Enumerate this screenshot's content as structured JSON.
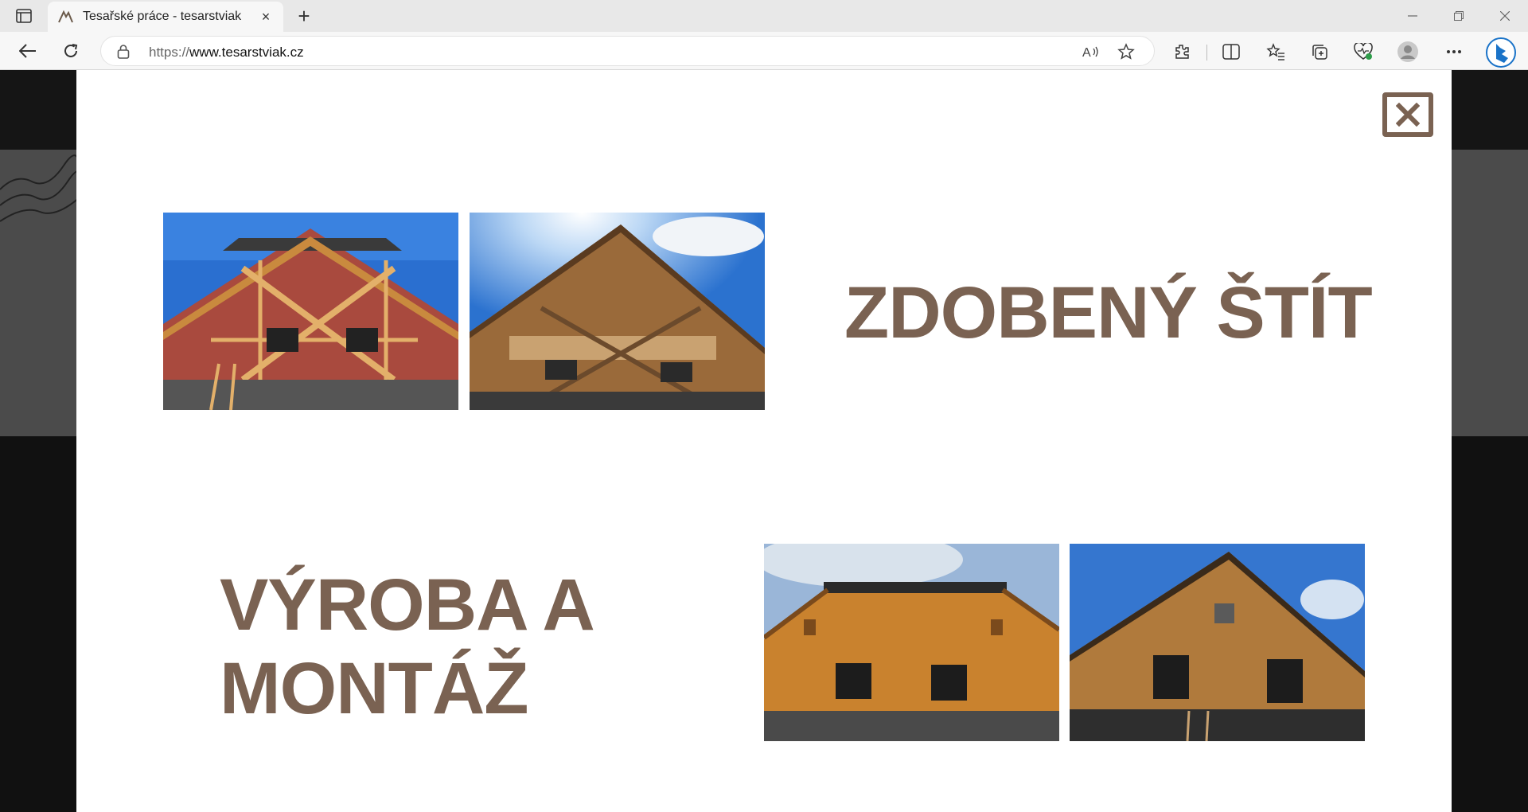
{
  "browser": {
    "tab_title": "Tesařské práce - tesarstviak",
    "tab_close": "×",
    "new_tab": "+",
    "url_scheme": "https://",
    "url_host": "www.tesarstviak.cz"
  },
  "modal": {
    "section1_title": "ZDOBENÝ ŠTÍT",
    "section2_title_line1": "VÝROBA A",
    "section2_title_line2": "MONTÁŽ"
  },
  "colors": {
    "accent": "#7a6252"
  }
}
